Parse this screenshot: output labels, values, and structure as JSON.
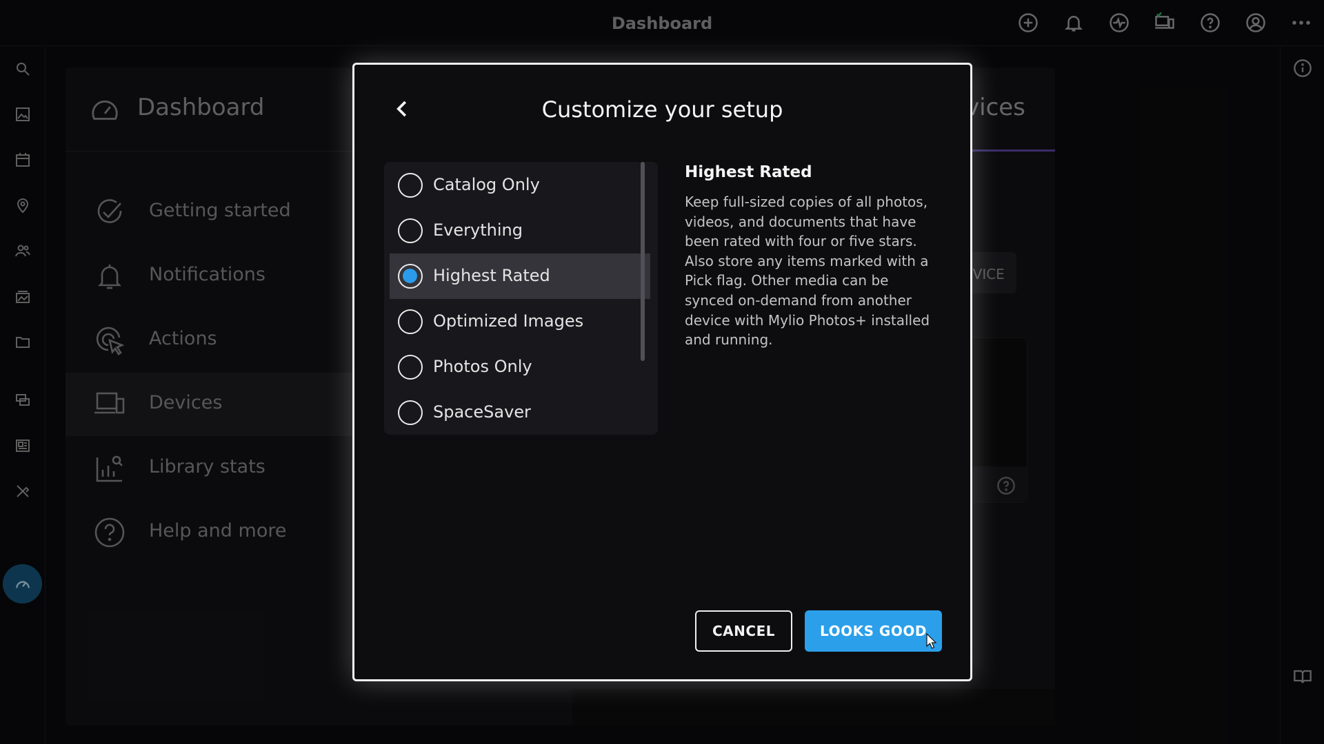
{
  "topbar": {
    "title": "Dashboard",
    "icons": [
      "add-circle-icon",
      "bell-icon",
      "activity-icon",
      "devices-icon",
      "help-icon",
      "account-icon",
      "more-icon"
    ]
  },
  "rail": {
    "icons": [
      "search-icon",
      "photos-icon",
      "calendar-icon",
      "map-pin-icon",
      "people-icon",
      "albums-icon",
      "folder-icon",
      "sources-icon",
      "layouts-icon",
      "tools-icon",
      "dashboard-icon"
    ],
    "active": "dashboard-icon"
  },
  "right_rail": {
    "icons": [
      "info-icon",
      "book-icon"
    ]
  },
  "dashboard": {
    "title": "Dashboard",
    "menu": [
      {
        "label": "Getting started",
        "icon": "check-circle-icon"
      },
      {
        "label": "Notifications",
        "icon": "bell-icon"
      },
      {
        "label": "Actions",
        "icon": "pointer-icon"
      },
      {
        "label": "Devices",
        "icon": "devices-icon",
        "active": true
      },
      {
        "label": "Library stats",
        "icon": "stats-icon"
      },
      {
        "label": "Help and more",
        "icon": "help-icon"
      }
    ],
    "right_title_fragment": "vices",
    "device_button_fragment": "EVICE"
  },
  "modal": {
    "title": "Customize your setup",
    "options": [
      {
        "label": "Catalog Only",
        "selected": false
      },
      {
        "label": "Everything",
        "selected": false
      },
      {
        "label": "Highest Rated",
        "selected": true
      },
      {
        "label": "Optimized Images",
        "selected": false
      },
      {
        "label": "Photos Only",
        "selected": false
      },
      {
        "label": "SpaceSaver",
        "selected": false
      }
    ],
    "description": {
      "title": "Highest Rated",
      "body": "Keep full-sized copies of all photos, videos, and documents that have been rated with four or five stars. Also store any items marked with a Pick flag. Other media can be synced on-demand from another device with Mylio Photos+ installed and running."
    },
    "cancel_label": "CANCEL",
    "ok_label": "LOOKS GOOD"
  },
  "colors": {
    "accent": "#2b9fe9",
    "active_rail": "#15587f",
    "tab_underline": "#5d4aa8"
  }
}
